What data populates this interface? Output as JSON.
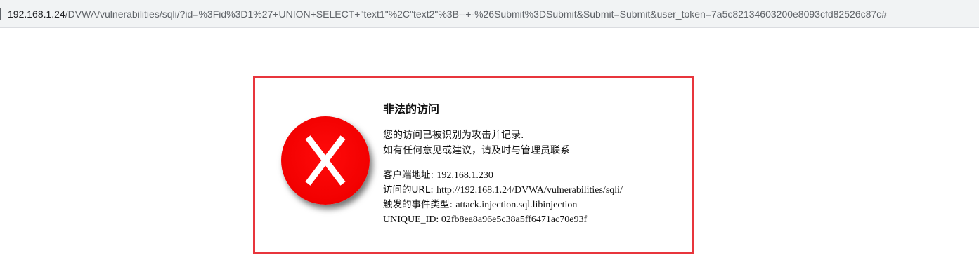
{
  "browser": {
    "url_host": "192.168.1.24",
    "url_rest": "/DVWA/vulnerabilities/sqli/?id=%3Fid%3D1%27+UNION+SELECT+\"text1\"%2C\"text2\"%3B--+-%26Submit%3DSubmit&Submit=Submit&user_token=7a5c82134603200e8093cfd82526c87c#"
  },
  "alert": {
    "icon": "red-x-circle-icon",
    "accent_color": "#e8353c",
    "title": "非法的访问",
    "message_line1": "您的访问已被识别为攻击并记录.",
    "message_line2": "如有任何意见或建议，请及时与管理员联系",
    "details": {
      "client_ip_label": "客户端地址: ",
      "client_ip": "192.168.1.230",
      "url_label": "访问的URL: ",
      "url": "http://192.168.1.24/DVWA/vulnerabilities/sqli/",
      "event_label": "触发的事件类型: ",
      "event": "attack.injection.sql.libinjection",
      "unique_id_label": "UNIQUE_ID: ",
      "unique_id": "02fb8ea8a96e5c38a5ff6471ac70e93f"
    }
  }
}
